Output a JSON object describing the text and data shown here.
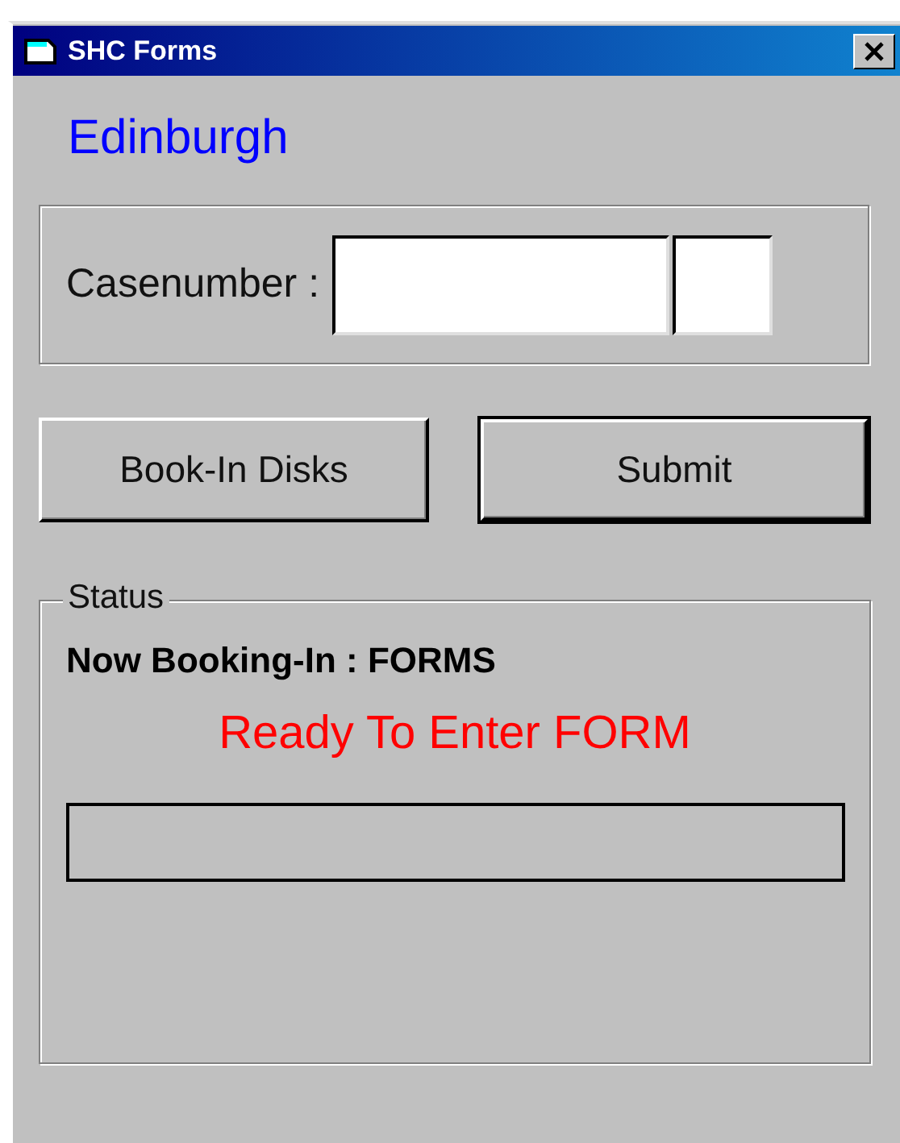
{
  "window": {
    "title": "SHC Forms"
  },
  "location": "Edinburgh",
  "case_frame": {
    "label": "Casenumber :",
    "fields": [
      {
        "kind": "main"
      },
      {
        "kind": "suffix"
      }
    ]
  },
  "buttons": [
    {
      "label": "Book-In Disks",
      "default": false
    },
    {
      "label": "Submit",
      "default": true
    }
  ],
  "status": {
    "title": "Status",
    "booking": "Now Booking-In : FORMS",
    "message": "Ready To Enter FORM",
    "progress": {
      "level": 0
    }
  }
}
